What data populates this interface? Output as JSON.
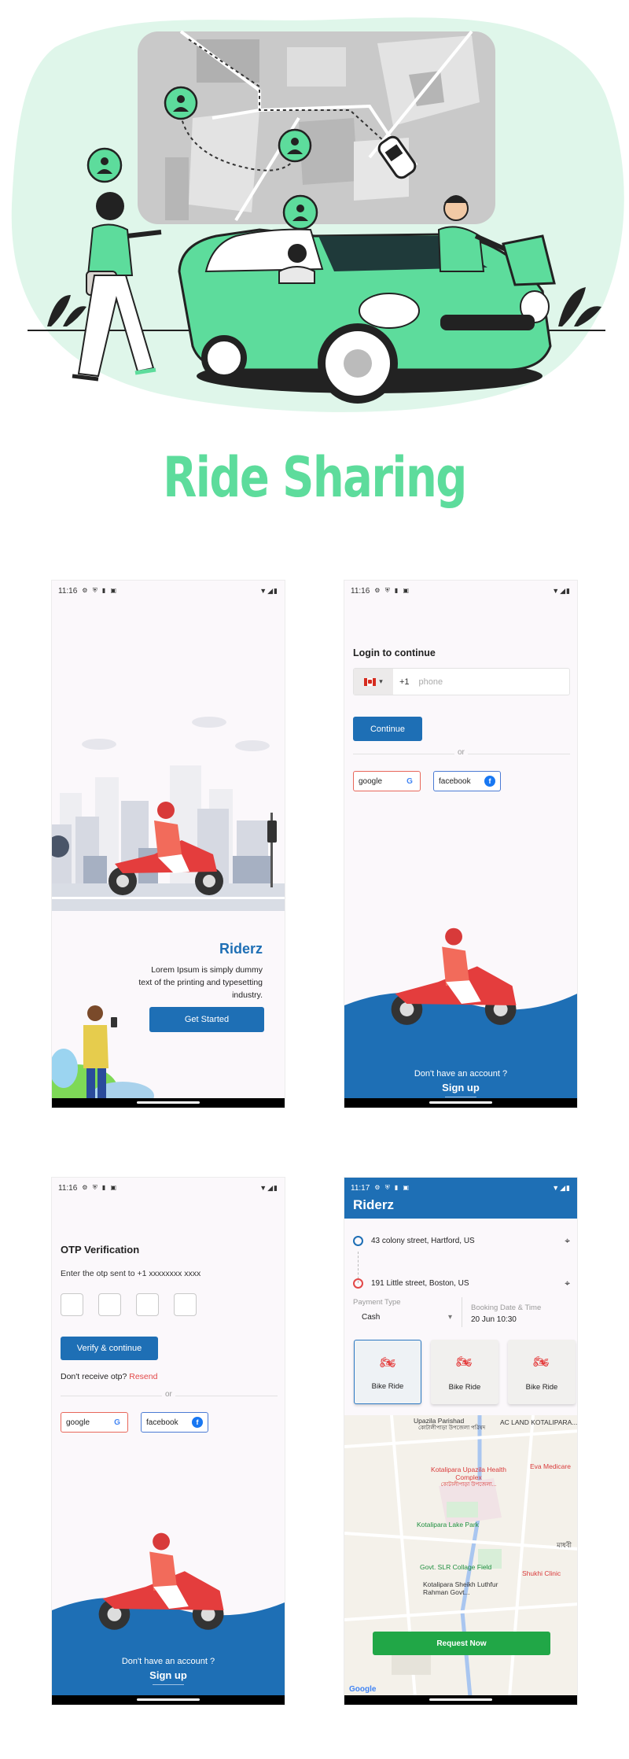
{
  "title": "Ride Sharing",
  "status": {
    "time_a": "11:16",
    "time_b": "11:17"
  },
  "onboarding": {
    "brand": "Riderz",
    "description": "Lorem Ipsum is simply dummy text of the printing and typesetting industry.",
    "cta": "Get Started"
  },
  "login": {
    "heading": "Login to continue",
    "dial_code": "+1",
    "phone_placeholder": "phone",
    "continue_label": "Continue",
    "or": "or",
    "google": "google",
    "facebook": "facebook",
    "no_account": "Don't have an account ?",
    "signup": "Sign up"
  },
  "otp": {
    "heading": "OTP Verification",
    "subtitle": "Enter the otp sent to +1 xxxxxxxx xxxx",
    "verify_label": "Verify & continue",
    "not_received": "Don't receive otp?",
    "resend": "Resend",
    "or": "or",
    "google": "google",
    "facebook": "facebook",
    "no_account": "Don't have an account ?",
    "signup": "Sign up"
  },
  "booking": {
    "app_title": "Riderz",
    "pickup": "43 colony street, Hartford, US",
    "dropoff": "191 Little street, Boston, US",
    "payment_label": "Payment Type",
    "payment_value": "Cash",
    "date_label": "Booking Date & Time",
    "date_value": "20 Jun 10:30",
    "rides": [
      "Bike Ride",
      "Bike Ride",
      "Bike Ride"
    ],
    "map_labels": {
      "upazila": "Upazila Parishad",
      "upazila_bn": "কোটালীপাড়া উপজেলা পরিষদ",
      "acland": "AC LAND KOTALIPARA...",
      "health": "Kotalipara Upazila Health Complex",
      "health_bn": "কোটালীপাড়া উপজেলা...",
      "eva": "Eva Medicare",
      "lake": "Kotalipara Lake Park",
      "bn_side": "মাধবী",
      "slr": "Govt. SLR Collage Field",
      "shukhi": "Shukhi Clinic",
      "lutfur": "Kotalipara Sheikh Luthfur Rahman Govt..."
    },
    "request_label": "Request Now",
    "google": "Google"
  },
  "colors": {
    "brand_blue": "#1e6fb5",
    "mint": "#5ddc9c",
    "green_button": "#21a747",
    "accent_red": "#e24848"
  }
}
